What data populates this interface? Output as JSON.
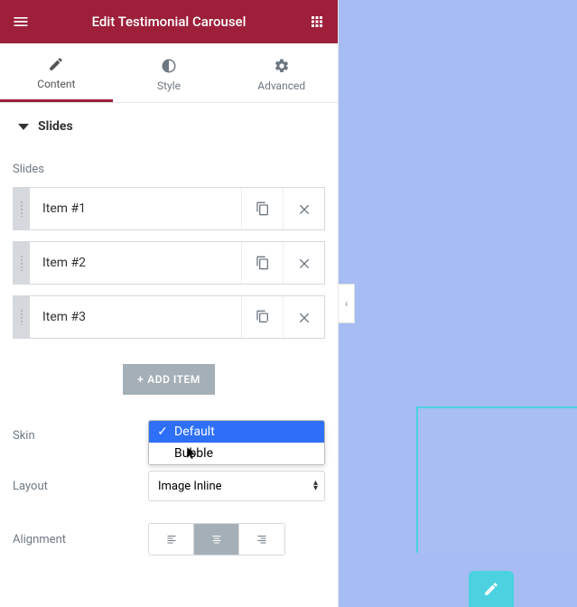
{
  "header": {
    "title": "Edit Testimonial Carousel"
  },
  "tabs": [
    {
      "label": "Content",
      "active": true
    },
    {
      "label": "Style",
      "active": false
    },
    {
      "label": "Advanced",
      "active": false
    }
  ],
  "section": {
    "title": "Slides"
  },
  "slides": {
    "label": "Slides",
    "items": [
      {
        "title": "Item #1"
      },
      {
        "title": "Item #2"
      },
      {
        "title": "Item #3"
      }
    ],
    "add_button": "ADD ITEM"
  },
  "skin": {
    "label": "Skin",
    "options": [
      {
        "label": "Default",
        "selected": true
      },
      {
        "label": "Bubble",
        "selected": false
      }
    ]
  },
  "layout": {
    "label": "Layout",
    "value": "Image Inline"
  },
  "alignment": {
    "label": "Alignment"
  },
  "colors": {
    "brand": "#9d1f3a",
    "accent": "#4bd1e0",
    "preview_bg": "#a6bcf2",
    "muted": "#a4afb7"
  }
}
